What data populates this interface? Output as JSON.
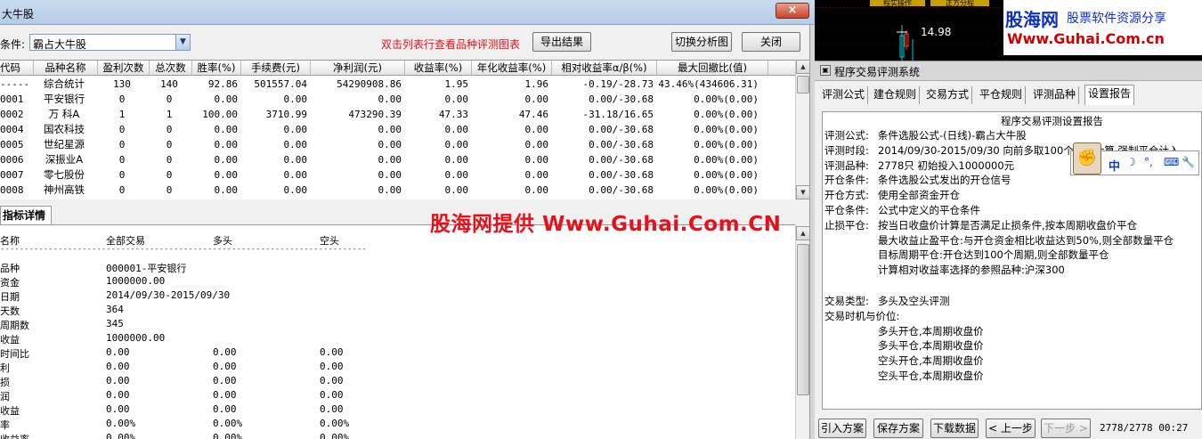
{
  "left_window": {
    "title": "大牛股",
    "close_glyph": "×",
    "condition_label": "条件:",
    "condition_value": "霸占大牛股",
    "hint": "双击列表行查看品种评测图表",
    "export_button": "导出结果",
    "switch_button": "切换分析图",
    "close_button": "关闭",
    "table": {
      "columns": [
        "代码",
        "品种名称",
        "盈利次数",
        "总次数",
        "胜率(%)",
        "手续费(元)",
        "净利润(元)",
        "收益率(%)",
        "年化收益率(%)",
        "相对收益率α/β(%)",
        "最大回撤比(值)"
      ],
      "rows": [
        [
          "-----",
          "综合统计",
          "130",
          "140",
          "92.86",
          "501557.04",
          "54290908.86",
          "1.95",
          "1.96",
          "-0.19/-28.73",
          "43.46%(434606.31)"
        ],
        [
          "0001",
          "平安银行",
          "0",
          "0",
          "0.00",
          "0.00",
          "0.00",
          "0.00",
          "0.00",
          "0.00/-30.68",
          "0.00%(0.00)"
        ],
        [
          "0002",
          "万  科A",
          "1",
          "1",
          "100.00",
          "3710.99",
          "473290.39",
          "47.33",
          "47.46",
          "-31.18/16.65",
          "0.00%(0.00)"
        ],
        [
          "0004",
          "国农科技",
          "0",
          "0",
          "0.00",
          "0.00",
          "0.00",
          "0.00",
          "0.00",
          "0.00/-30.68",
          "0.00%(0.00)"
        ],
        [
          "0005",
          "世纪星源",
          "0",
          "0",
          "0.00",
          "0.00",
          "0.00",
          "0.00",
          "0.00",
          "0.00/-30.68",
          "0.00%(0.00)"
        ],
        [
          "0006",
          "深振业A",
          "0",
          "0",
          "0.00",
          "0.00",
          "0.00",
          "0.00",
          "0.00",
          "0.00/-30.68",
          "0.00%(0.00)"
        ],
        [
          "0007",
          "零七股份",
          "0",
          "0",
          "0.00",
          "0.00",
          "0.00",
          "0.00",
          "0.00",
          "0.00/-30.68",
          "0.00%(0.00)"
        ],
        [
          "0008",
          "神州高铁",
          "0",
          "0",
          "0.00",
          "0.00",
          "0.00",
          "0.00",
          "0.00",
          "0.00/-30.68",
          "0.00%(0.00)"
        ]
      ]
    },
    "detail_tab": "指标详情",
    "detail": {
      "headers": [
        "名称",
        "全部交易",
        "多头",
        "空头"
      ],
      "divider": "------------------------------------------------------------------------------------------",
      "rows": [
        [
          "品种",
          "000001-平安银行",
          "",
          ""
        ],
        [
          "资金",
          "1000000.00",
          "",
          ""
        ],
        [
          "日期",
          "2014/09/30-2015/09/30",
          "",
          ""
        ],
        [
          "天数",
          "364",
          "",
          ""
        ],
        [
          "周期数",
          "345",
          "",
          ""
        ],
        [
          "收益",
          "1000000.00",
          "",
          ""
        ],
        [
          "时间比",
          "0.00",
          "0.00",
          "0.00"
        ],
        [
          "利",
          "0.00",
          "0.00",
          "0.00"
        ],
        [
          "损",
          "0.00",
          "0.00",
          "0.00"
        ],
        [
          "润",
          "0.00",
          "0.00",
          "0.00"
        ],
        [
          "收益",
          "0.00",
          "0.00",
          "0.00"
        ],
        [
          "率",
          "0.00%",
          "0.00%",
          "0.00%"
        ],
        [
          "收益率",
          "0.00%",
          "0.00%",
          "0.00%"
        ]
      ]
    },
    "watermark": "股海网提供 Www.Guhai.Com.CN"
  },
  "right_panel": {
    "chart_price": "14.98",
    "top_tabs": [
      "程实操作",
      "正方分程"
    ],
    "logo_main": "股海网",
    "logo_sub": "股票软件资源分享",
    "logo_url": "Www.Guhai.Com.cn",
    "window_title": "程序交易评测系统",
    "tabs": [
      "评测公式",
      "建仓规则",
      "交易方式",
      "平仓规则",
      "评测品种",
      "设置报告"
    ],
    "report_title": "程序交易评测设置报告",
    "report_lines": [
      {
        "label": "评测公式:",
        "text": "条件选股公式-(日线)-霸占大牛股"
      },
      {
        "label": "评测时段:",
        "text": "2014/09/30-2015/09/30 向前多取100个数据计算,强制平仓计入"
      },
      {
        "label": "评测品种:",
        "text": "2778只  初始投入1000000元"
      },
      {
        "label": "开仓条件:",
        "text": "条件选股公式发出的开仓信号"
      },
      {
        "label": "开仓方式:",
        "text": "使用全部资金开仓"
      },
      {
        "label": "平仓条件:",
        "text": "公式中定义的平仓条件"
      },
      {
        "label": "止损平仓:",
        "text": "按当日收盘价计算是否满足止损条件,按本周期收盘价平仓"
      },
      {
        "label": "",
        "text": "最大收益止盈平仓:与开仓资金相比收益达到50%,则全部数量平仓"
      },
      {
        "label": "",
        "text": "目标周期平仓:开仓达到100个周期,则全部数量平仓"
      },
      {
        "label": "",
        "text": "计算相对收益率选择的参照品种:沪深300"
      },
      {
        "label": "交易类型:",
        "text": "多头及空头评测"
      },
      {
        "label": "交易时机与价位:",
        "text": ""
      },
      {
        "label": "",
        "text": "多头开仓,本周期收盘价"
      },
      {
        "label": "",
        "text": "多头平仓,本周期收盘价"
      },
      {
        "label": "",
        "text": "空头开仓,本周期收盘价"
      },
      {
        "label": "",
        "text": "空头平仓,本周期收盘价"
      }
    ],
    "ime_label": "中",
    "buttons": [
      "引入方案",
      "保存方案",
      "下载数据",
      "< 上一步",
      "下一步 >"
    ],
    "status": "2778/2778 00:27"
  },
  "colors": {
    "accent_red": "#e8101a",
    "chart_line": "#00d0d0",
    "logo_blue": "#1030c0",
    "logo_red": "#d00000"
  }
}
